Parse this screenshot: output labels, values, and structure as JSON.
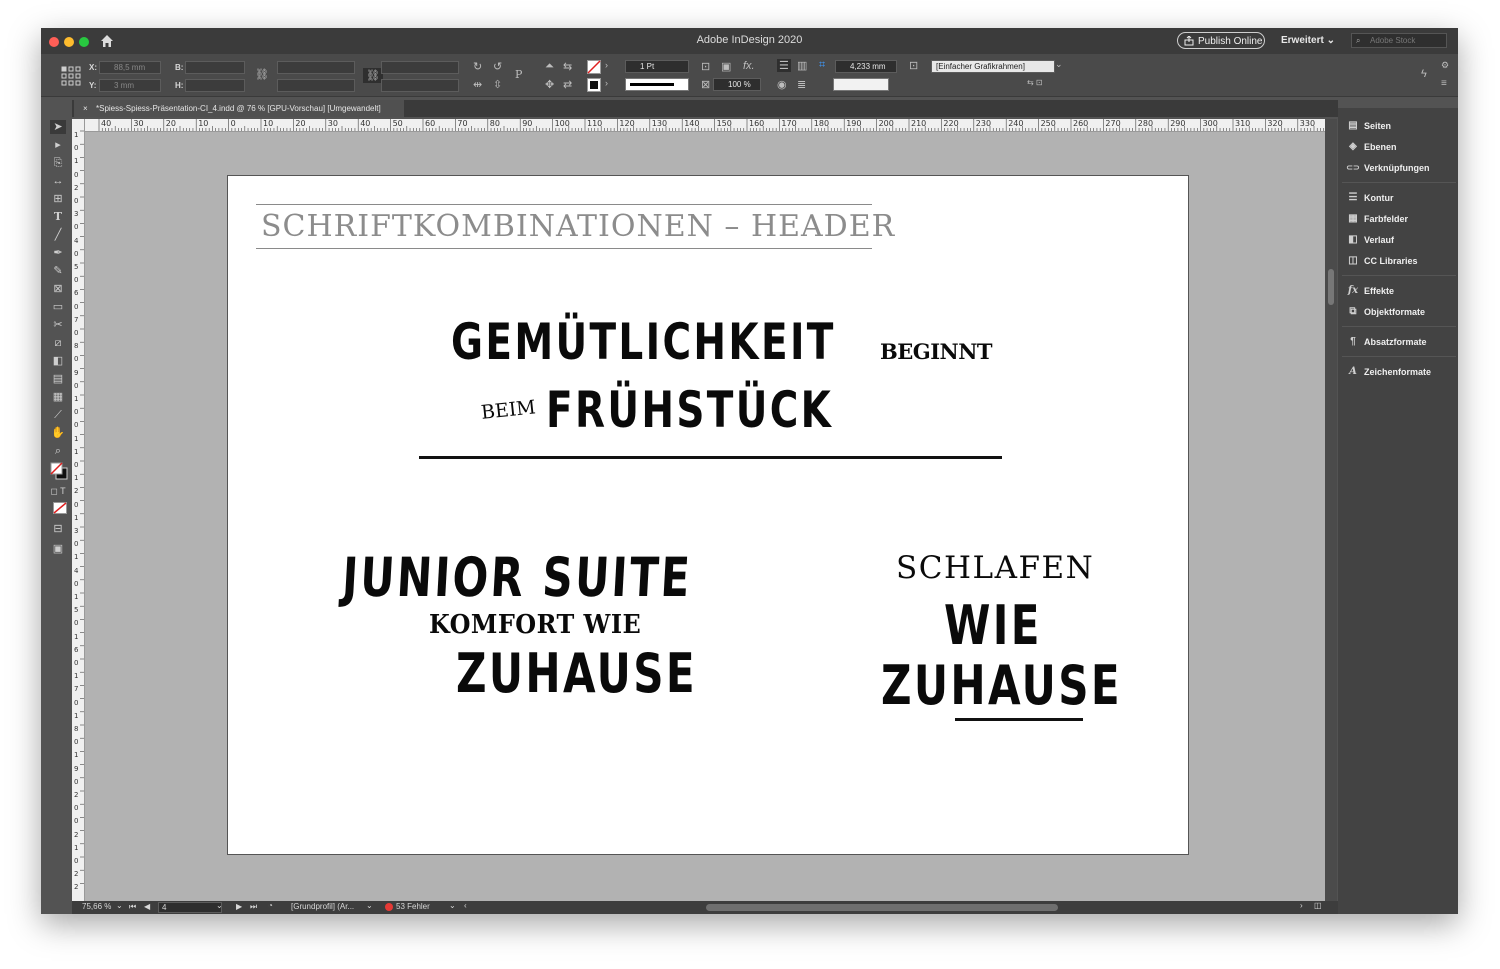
{
  "window": {
    "title": "Adobe InDesign 2020",
    "publish_label": "Publish Online",
    "workspace_label": "Erweitert",
    "stock_placeholder": "Adobe Stock"
  },
  "control": {
    "x_label": "X:",
    "x_value": "88,5 mm",
    "y_label": "Y:",
    "y_value": "3 mm",
    "w_label": "B:",
    "h_label": "H:",
    "stroke_weight": "1 Pt",
    "scale_value": "100 %",
    "offset_value": "4,233 mm",
    "object_style": "[Einfacher Grafikrahmen]"
  },
  "document_tab": {
    "label": "*Spiess-Spiess-Präsentation-CI_4.indd @ 76 % [GPU-Vorschau] [Umgewandelt]",
    "close": "×"
  },
  "ruler_h": [
    "40",
    "30",
    "20",
    "10",
    "0",
    "10",
    "20",
    "30",
    "40",
    "50",
    "60",
    "70",
    "80",
    "90",
    "100",
    "110",
    "120",
    "130",
    "140",
    "150",
    "160",
    "170",
    "180",
    "190",
    "200",
    "210",
    "220",
    "230",
    "240",
    "250",
    "260",
    "270",
    "280",
    "290",
    "300",
    "310",
    "320",
    "330"
  ],
  "ruler_v": [
    "1",
    "0",
    "1",
    "0",
    "2",
    "0",
    "3",
    "0",
    "4",
    "0",
    "5",
    "0",
    "6",
    "0",
    "7",
    "0",
    "8",
    "0",
    "9",
    "0",
    "1",
    "0",
    "0",
    "1",
    "1",
    "0",
    "1",
    "2",
    "0",
    "1",
    "3",
    "0",
    "1",
    "4",
    "0",
    "1",
    "5",
    "0",
    "1",
    "6",
    "0",
    "1",
    "7",
    "0",
    "1",
    "8",
    "0",
    "1",
    "9",
    "0",
    "2",
    "0",
    "0",
    "2",
    "1",
    "0",
    "2",
    "2"
  ],
  "page": {
    "header": "SCHRIFTKOMBINATIONEN – HEADER",
    "line1_main": "GEMÜTLICHKEIT",
    "line1_small": "BEGINNT",
    "line2_small": "BEIM",
    "line2_main": "FRÜHSTÜCK",
    "junior_main": "JUNIOR SUITE",
    "junior_small": "KOMFORT WIE",
    "junior_bottom": "ZUHAUSE",
    "schlafen": "SCHLAFEN",
    "wie": "WIE",
    "zuhause": "ZUHAUSE"
  },
  "status": {
    "zoom": "75,66 %",
    "page_number": "4",
    "profile": "[Grundprofil] (Ar...",
    "errors": "53 Fehler"
  },
  "panels": [
    {
      "icon": "pages-icon",
      "glyph": "▤",
      "label": "Seiten"
    },
    {
      "icon": "layers-icon",
      "glyph": "◈",
      "label": "Ebenen"
    },
    {
      "icon": "links-icon",
      "glyph": "⊂⊃",
      "label": "Verknüpfungen"
    },
    {
      "icon": "stroke-icon",
      "glyph": "☰",
      "label": "Kontur"
    },
    {
      "icon": "swatches-icon",
      "glyph": "▦",
      "label": "Farbfelder"
    },
    {
      "icon": "gradient-icon",
      "glyph": "◧",
      "label": "Verlauf"
    },
    {
      "icon": "cc-libraries-icon",
      "glyph": "◫",
      "label": "CC Libraries"
    },
    {
      "icon": "effects-icon",
      "glyph": "fx",
      "label": "Effekte"
    },
    {
      "icon": "object-styles-icon",
      "glyph": "⧉",
      "label": "Objektformate"
    },
    {
      "icon": "paragraph-styles-icon",
      "glyph": "¶",
      "label": "Absatzformate"
    },
    {
      "icon": "character-styles-icon",
      "glyph": "A",
      "label": "Zeichenformate"
    }
  ]
}
